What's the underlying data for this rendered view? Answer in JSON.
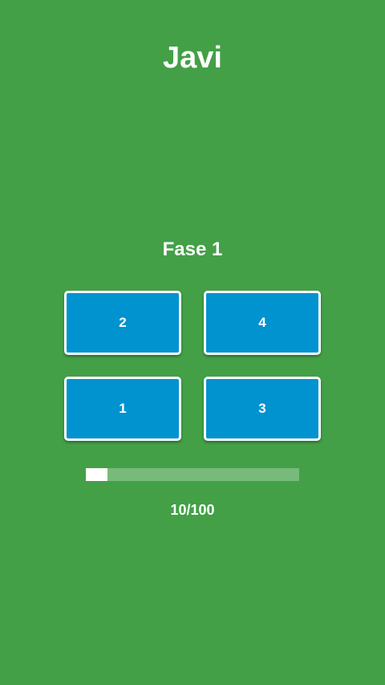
{
  "player": {
    "name": "Javi"
  },
  "phase": {
    "title": "Fase 1"
  },
  "tiles": [
    {
      "label": "2"
    },
    {
      "label": "4"
    },
    {
      "label": "1"
    },
    {
      "label": "3"
    }
  ],
  "progress": {
    "current": 10,
    "total": 100,
    "label": "10/100"
  },
  "colors": {
    "background": "#43a047",
    "tile": "#0093d0",
    "tile_border": "#ffffff",
    "progress_fill": "#ffffff"
  }
}
